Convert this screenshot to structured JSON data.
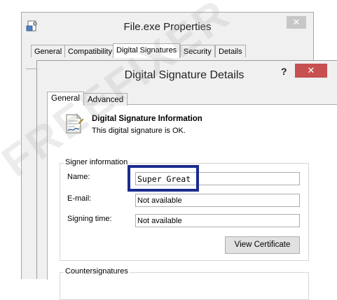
{
  "back_window": {
    "title": "File.exe Properties",
    "close_glyph": "✕",
    "tabs": [
      "General",
      "Compatibility",
      "Digital Signatures",
      "Security",
      "Details"
    ],
    "selected_tab": "Digital Signatures"
  },
  "dialog": {
    "title": "Digital Signature Details",
    "help_glyph": "?",
    "close_glyph": "✕",
    "tabs": [
      "General",
      "Advanced"
    ],
    "selected_tab": "General",
    "info": {
      "icon": "certificate-document-icon",
      "title": "Digital Signature Information",
      "status": "This digital signature is OK."
    },
    "signer_group": {
      "label": "Signer information",
      "name_label": "Name:",
      "name_value": "Super Great",
      "email_label": "E-mail:",
      "email_value": "Not available",
      "time_label": "Signing time:",
      "time_value": "Not available",
      "view_certificate_label": "View Certificate"
    },
    "counter_group": {
      "label": "Countersignatures"
    }
  },
  "watermark_text": "FREEFIXER",
  "colors": {
    "highlight_border": "#1a2c8e",
    "close_button": "#c75050"
  }
}
